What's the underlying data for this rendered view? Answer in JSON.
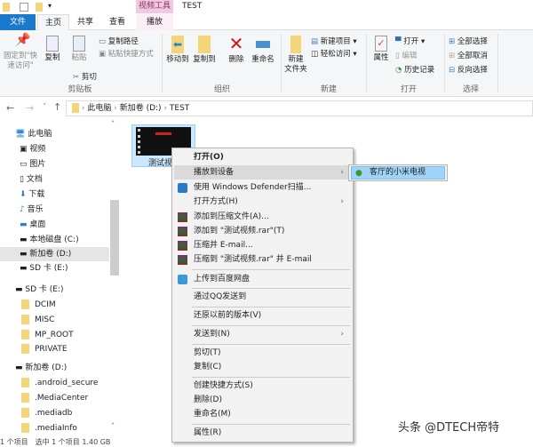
{
  "window": {
    "title": "TEST",
    "context_tab_group": "视频工具"
  },
  "tabs": [
    "文件",
    "主页",
    "共享",
    "查看",
    "播放"
  ],
  "ribbon": {
    "clipboard": {
      "label": "剪贴板",
      "pin": "固定到\"快速访问\"",
      "copy": "复制",
      "paste": "粘贴",
      "copy_path": "复制路径",
      "paste_shortcut": "粘贴快捷方式",
      "cut": "剪切"
    },
    "organize": {
      "label": "组织",
      "move_to": "移动到",
      "copy_to": "复制到",
      "delete": "删除",
      "rename": "重命名"
    },
    "new": {
      "label": "新建",
      "new_folder": "新建\n文件夹",
      "new_item": "新建项目 ▾",
      "easy_access": "轻松访问 ▾"
    },
    "open": {
      "label": "打开",
      "properties": "属性",
      "open": "打开 ▾",
      "edit": "编辑",
      "history": "历史记录"
    },
    "select": {
      "label": "选择",
      "select_all": "全部选择",
      "select_none": "全部取消",
      "invert": "反向选择"
    }
  },
  "address": {
    "crumbs": [
      "此电脑",
      "新加卷 (D:)",
      "TEST"
    ]
  },
  "nav": {
    "items": [
      "此电脑",
      "视频",
      "图片",
      "文档",
      "下载",
      "音乐",
      "桌面",
      "本地磁盘 (C:)",
      "新加卷 (D:)",
      "SD 卡 (E:)",
      "SD 卡 (E:)",
      "DCIM",
      "MISC",
      "MP_ROOT",
      "PRIVATE",
      "新加卷 (D:)",
      ".android_secure",
      ".MediaCenter",
      ".mediadb",
      ".mediaInfo"
    ]
  },
  "file": {
    "name": "测试视频"
  },
  "menu": {
    "items": [
      "打开(O)",
      "播放到设备",
      "使用 Windows Defender扫描...",
      "打开方式(H)",
      "添加到压缩文件(A)...",
      "添加到 \"测试视频.rar\"(T)",
      "压缩并 E-mail...",
      "压缩到 \"测试视频.rar\" 并 E-mail",
      "上传到百度网盘",
      "通过QQ发送到",
      "还原以前的版本(V)",
      "发送到(N)",
      "剪切(T)",
      "复制(C)",
      "创建快捷方式(S)",
      "删除(D)",
      "重命名(M)",
      "属性(R)"
    ]
  },
  "submenu": {
    "items": [
      "客厅的小米电视"
    ]
  },
  "status": {
    "text": "1 个项目　选中 1 个项目 1.40 GB"
  },
  "watermark": {
    "text": "头条 @DTECH帝特",
    "logo": "路由器"
  },
  "colors": {
    "accent": "#1979ca",
    "context_tab": "#f4c6df",
    "highlight": "#9fd3f7"
  }
}
